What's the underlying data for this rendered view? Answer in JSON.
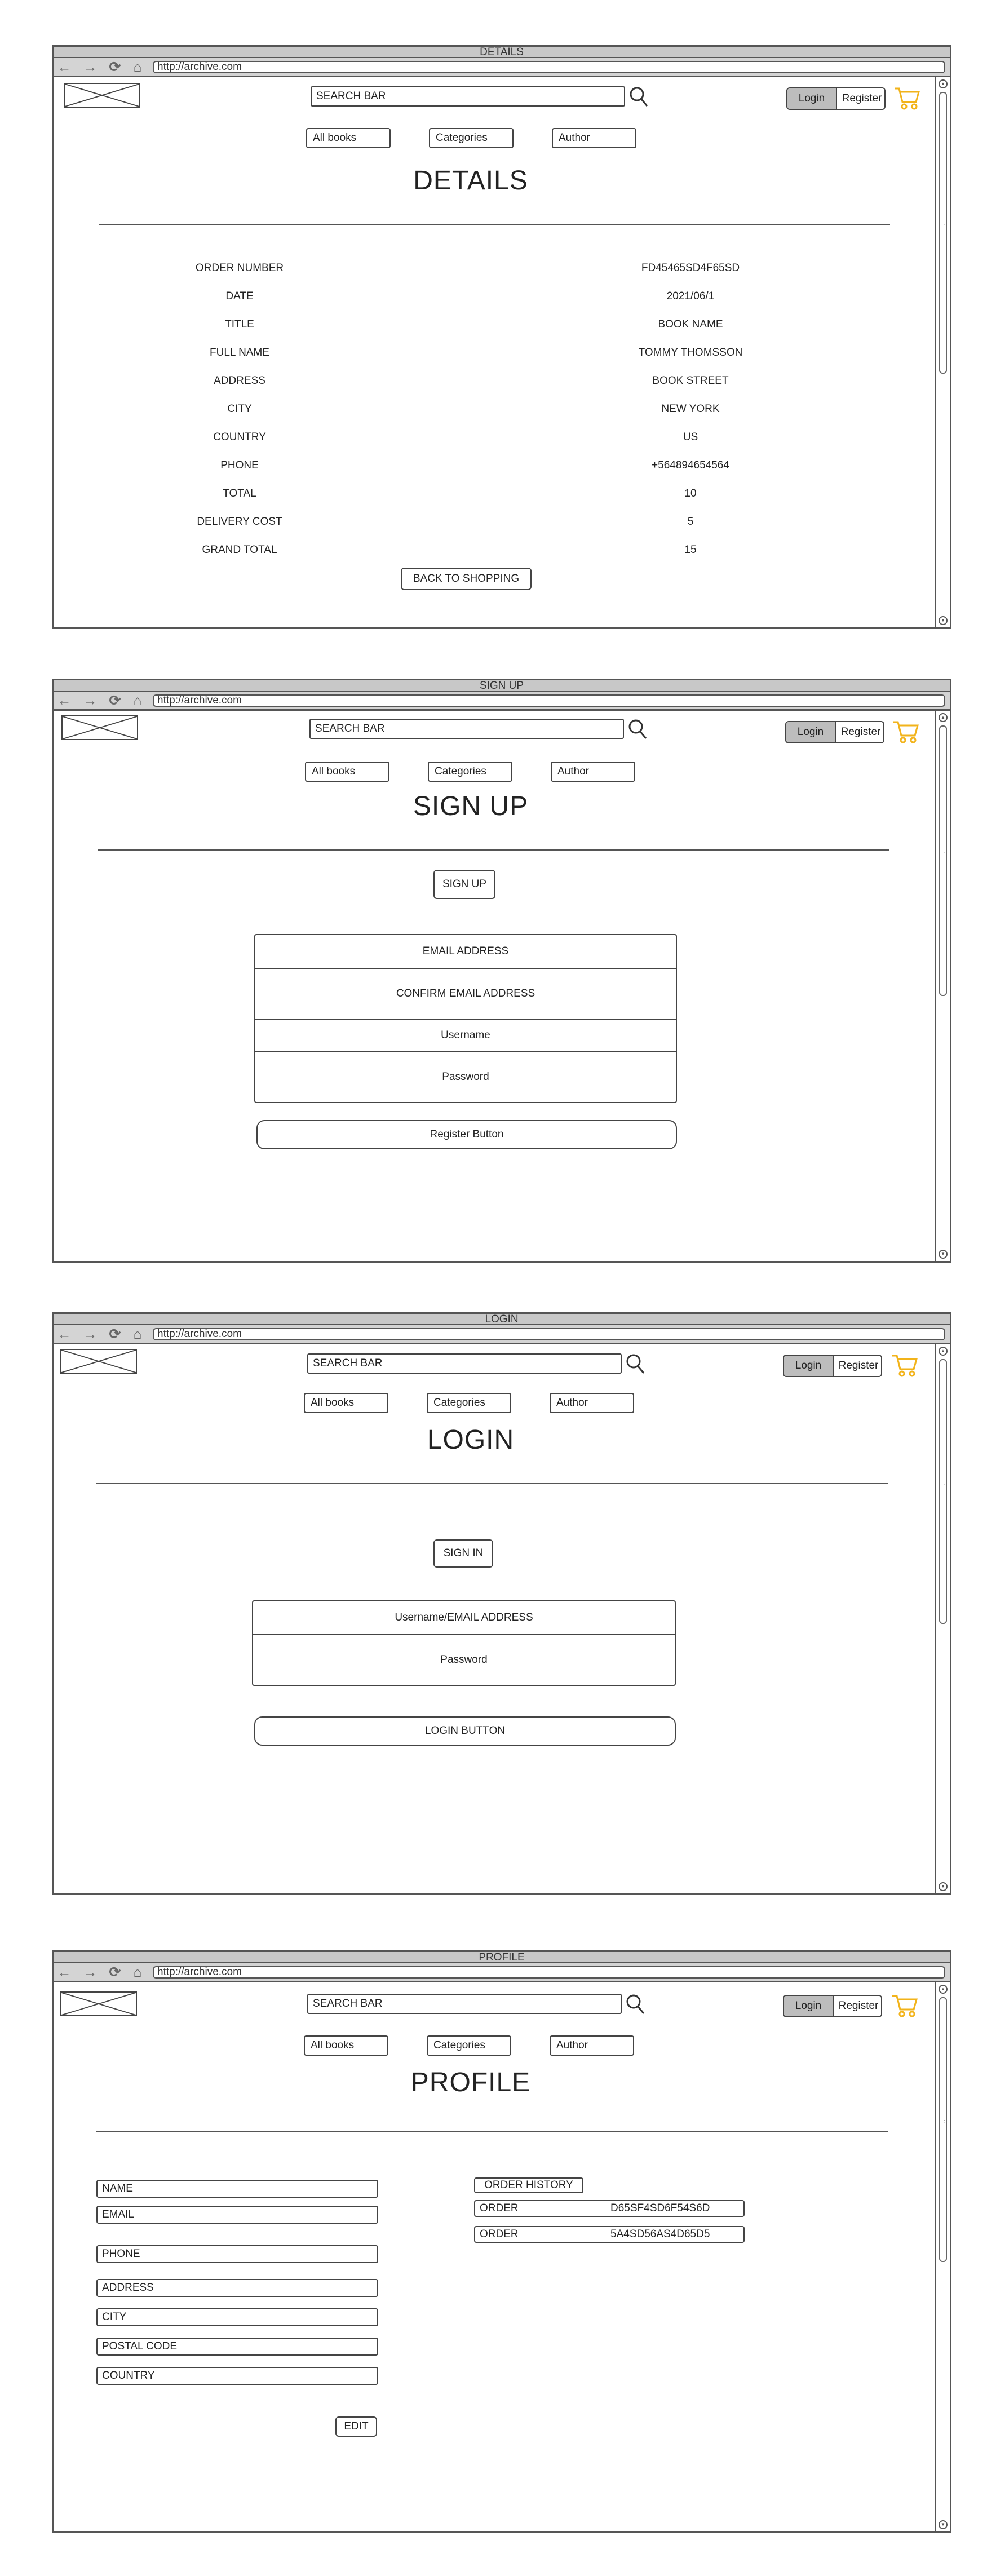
{
  "common": {
    "url": "http://archive.com",
    "search_placeholder": "SEARCH BAR",
    "login_label": "Login",
    "register_label": "Register",
    "nav": [
      "All books",
      "Categories",
      "Author"
    ],
    "icons": {
      "back": "arrow-left-icon",
      "forward": "arrow-right-icon",
      "reload": "reload-icon",
      "home": "home-icon",
      "search": "search-icon",
      "cart": "cart-icon",
      "logo": "logo-placeholder-icon"
    },
    "colors": {
      "cart": "#f2b31a",
      "login_bg": "#bdbdbd",
      "titlebar": "#c8c8c8"
    }
  },
  "details": {
    "window_title": "DETAILS",
    "heading": "DETAILS",
    "rows": [
      {
        "label": "ORDER NUMBER",
        "value": "FD45465SD4F65SD"
      },
      {
        "label": "DATE",
        "value": "2021/06/1"
      },
      {
        "label": "TITLE",
        "value": "BOOK NAME"
      },
      {
        "label": "FULL NAME",
        "value": "TOMMY THOMSSON"
      },
      {
        "label": "ADDRESS",
        "value": "BOOK STREET"
      },
      {
        "label": "CITY",
        "value": "NEW YORK"
      },
      {
        "label": "COUNTRY",
        "value": "US"
      },
      {
        "label": "PHONE",
        "value": "+564894654564"
      },
      {
        "label": "TOTAL",
        "value": "10"
      },
      {
        "label": "DELIVERY COST",
        "value": "5"
      },
      {
        "label": "GRAND TOTAL",
        "value": "15"
      }
    ],
    "back_button": "BACK TO SHOPPING"
  },
  "signup": {
    "window_title": "SIGN UP",
    "heading": "SIGN UP",
    "tab_button": "SIGN UP",
    "fields": [
      "EMAIL ADDRESS",
      "CONFIRM EMAIL ADDRESS",
      "Username",
      "Password"
    ],
    "register_button": "Register Button"
  },
  "login": {
    "window_title": "LOGIN",
    "heading": "LOGIN",
    "tab_button": "SIGN IN",
    "fields": [
      "Username/EMAIL ADDRESS",
      "Password"
    ],
    "login_button": "LOGIN BUTTON"
  },
  "profile": {
    "window_title": "PROFILE",
    "heading": "PROFILE",
    "fields": [
      "NAME",
      "EMAIL",
      "PHONE",
      "ADDRESS",
      "CITY",
      "POSTAL CODE",
      "COUNTRY"
    ],
    "order_history_label": "ORDER HISTORY",
    "orders": [
      {
        "label": "ORDER",
        "id": "D65SF4SD6F54S6D"
      },
      {
        "label": "ORDER",
        "id": "5A4SD56AS4D65D5"
      }
    ],
    "edit_button": "EDIT"
  }
}
